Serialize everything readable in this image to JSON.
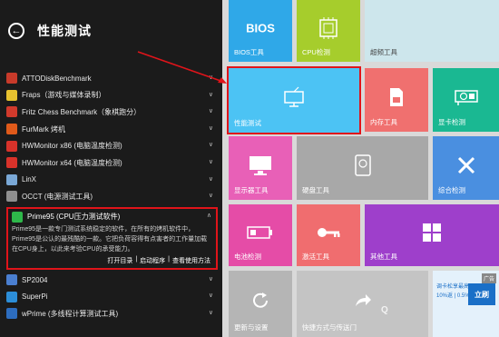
{
  "header": {
    "title": "性能测试"
  },
  "list": [
    {
      "label": "ATTODiskBenchmark",
      "color": "#c83a2a"
    },
    {
      "label": "Fraps（游戏与媒体录制）",
      "color": "#e6c12f"
    },
    {
      "label": "Fritz Chess Benchmark（象棋跑分）",
      "color": "#d13a2c"
    },
    {
      "label": "FurMark 烤机",
      "color": "#e05a1a"
    },
    {
      "label": "HWMonitor x86 (电脑温度检测)",
      "color": "#d8322a"
    },
    {
      "label": "HWMonitor x64 (电脑温度检测)",
      "color": "#d8322a"
    },
    {
      "label": "LinX",
      "color": "#7aa8d6"
    },
    {
      "label": "OCCT (电源测试工具)",
      "color": "#8f8f8f"
    }
  ],
  "expanded": {
    "title": "Prime95 (CPU压力测试软件)",
    "desc": "Prime95是一款专门测试系统稳定的软件，在所有的烤机软件中，Prime95是公认的最残酷的一款。它把负荷容得有点害者的工作量加载在CPU身上，以此来考验CPU的承受能力。",
    "links": [
      "打开目录",
      "启动程序",
      "查看使用方法"
    ]
  },
  "list_after": [
    {
      "label": "SP2004",
      "color": "#4a7fd0"
    },
    {
      "label": "SuperPi",
      "color": "#2c8ed8"
    },
    {
      "label": "wPrime (多线程计算测试工具)",
      "color": "#2d6dbf"
    }
  ],
  "tiles": {
    "bios": {
      "label": "BIOS工具",
      "text": "BIOS"
    },
    "cpu": {
      "label": "CPU检测",
      "text": "CPU"
    },
    "overclock": {
      "label": "超频工具"
    },
    "performance": {
      "label": "性能测试"
    },
    "memory": {
      "label": "内存工具"
    },
    "gpu": {
      "label": "显卡检测"
    },
    "display": {
      "label": "显示器工具"
    },
    "disk": {
      "label": "硬盘工具"
    },
    "comprehensive": {
      "label": "综合检测"
    },
    "battery": {
      "label": "电池检测"
    },
    "activate": {
      "label": "激活工具"
    },
    "other": {
      "label": "其他工具"
    },
    "update": {
      "label": "更新与设置"
    },
    "share": {
      "label": "快捷方式与传送门"
    }
  },
  "ad": {
    "tag": "广告",
    "line1": "调卡松享最高",
    "line2": "10%返 | 0.5%+3",
    "badge": "立刷"
  },
  "watermark": "Q",
  "colors": {
    "highlight": "#e0141a",
    "panel_bg": "#1b1b1b"
  }
}
